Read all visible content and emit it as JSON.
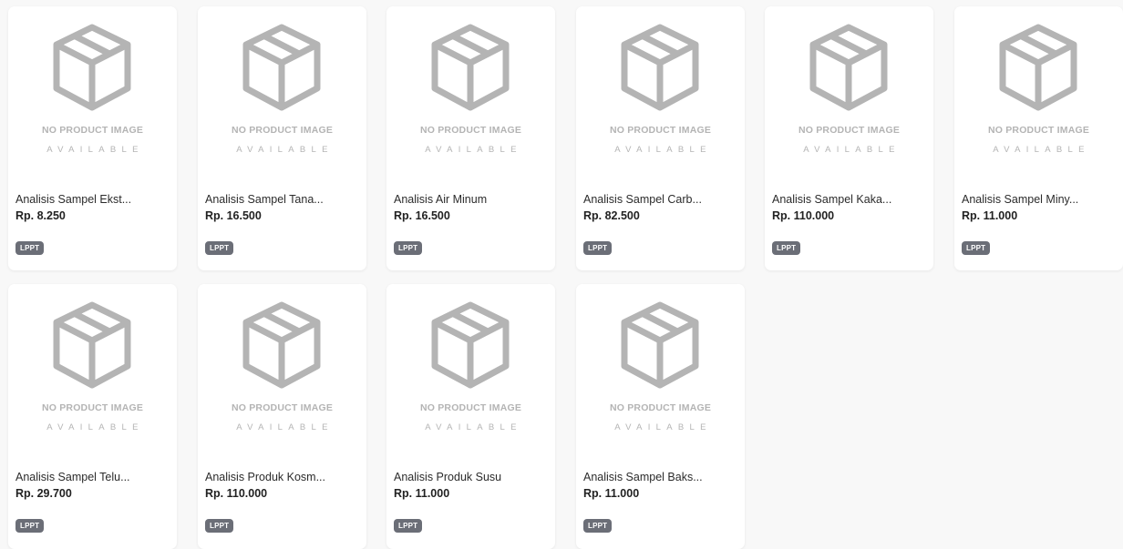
{
  "placeholder": {
    "line1": "NO PRODUCT IMAGE",
    "line2": "AVAILABLE"
  },
  "products": [
    {
      "name": "Analisis Sampel Ekst...",
      "price": "Rp. 8.250",
      "badge": "LPPT"
    },
    {
      "name": "Analisis Sampel Tana...",
      "price": "Rp. 16.500",
      "badge": "LPPT"
    },
    {
      "name": "Analisis Air Minum",
      "price": "Rp. 16.500",
      "badge": "LPPT"
    },
    {
      "name": "Analisis Sampel Carb...",
      "price": "Rp. 82.500",
      "badge": "LPPT"
    },
    {
      "name": "Analisis Sampel Kaka...",
      "price": "Rp. 110.000",
      "badge": "LPPT"
    },
    {
      "name": "Analisis Sampel Miny...",
      "price": "Rp. 11.000",
      "badge": "LPPT"
    },
    {
      "name": "Analisis Sampel Telu...",
      "price": "Rp. 29.700",
      "badge": "LPPT"
    },
    {
      "name": "Analisis Produk Kosm...",
      "price": "Rp. 110.000",
      "badge": "LPPT"
    },
    {
      "name": "Analisis Produk Susu",
      "price": "Rp. 11.000",
      "badge": "LPPT"
    },
    {
      "name": "Analisis Sampel Baks...",
      "price": "Rp. 11.000",
      "badge": "LPPT"
    }
  ],
  "colors": {
    "background": "#f8f8f8",
    "card": "#ffffff",
    "placeholder_gray": "#b4b4b4",
    "badge_bg": "#6b6e77"
  },
  "icons": {
    "placeholder": "box-icon"
  }
}
